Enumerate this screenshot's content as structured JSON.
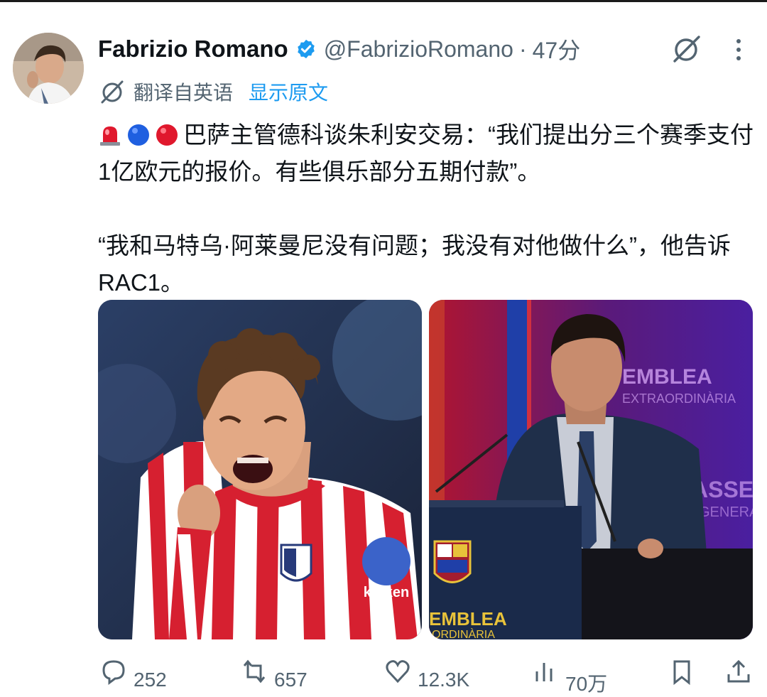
{
  "tweet": {
    "author_name": "Fabrizio Romano",
    "handle": "@FabrizioRomano",
    "separator": "·",
    "time": "47分",
    "translate_label": "翻译自英语",
    "show_original": "显示原文",
    "paragraph1": "巴萨主管德科谈朱利安交易：“我们提出分三个赛季支付1亿欧元的报价。有些俱乐部分五期付款”。",
    "paragraph2": "“我和马特乌·阿莱曼尼没有问题；我没有对他做什么”，他告诉RAC1。"
  },
  "images": {
    "left_badge_text": "kraken",
    "right_bg_text_top": "EMBLEA",
    "right_bg_text_sub": "EXTRAORDINÀRIA",
    "right_bottom_text": "EMBLEA",
    "right_bottom_sub": "ORDINÀRIA",
    "right_side_text": "ASSE",
    "right_side_sub": "GENERA"
  },
  "actions": {
    "replies": "252",
    "reposts": "657",
    "likes": "12.3K",
    "views": "70万"
  },
  "colors": {
    "accent": "#1d9bf0",
    "secondary_text": "#536471",
    "primary_text": "#0f1419"
  }
}
